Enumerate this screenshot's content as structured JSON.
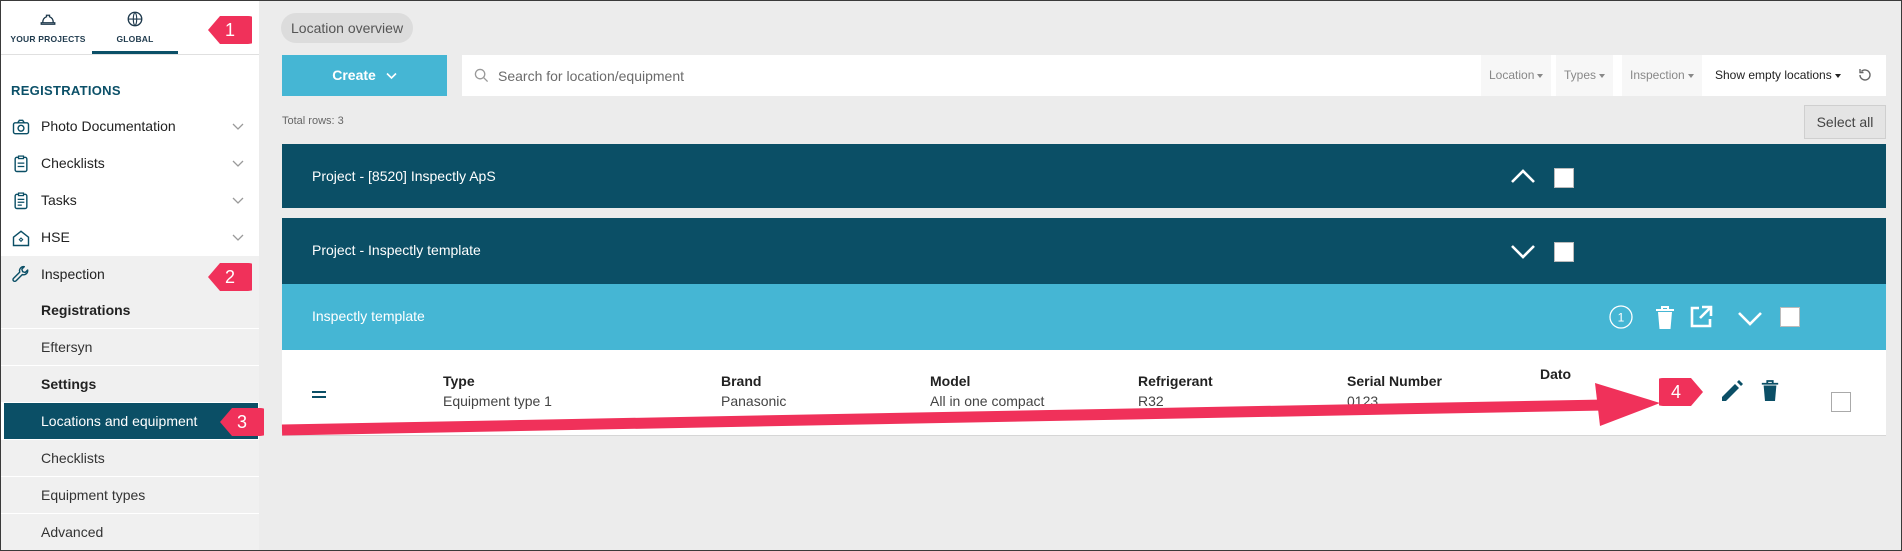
{
  "topnav": {
    "items": [
      {
        "label": "YOUR PROJECTS",
        "icon": "hard-hat-icon"
      },
      {
        "label": "GLOBAL",
        "icon": "globe-icon"
      }
    ]
  },
  "sidebar": {
    "section_title": "REGISTRATIONS",
    "items": [
      {
        "label": "Photo Documentation",
        "icon": "camera-icon"
      },
      {
        "label": "Checklists",
        "icon": "clipboard-icon"
      },
      {
        "label": "Tasks",
        "icon": "clipboard-list-icon"
      },
      {
        "label": "HSE",
        "icon": "house-icon"
      },
      {
        "label": "Inspection",
        "icon": "wrench-icon"
      }
    ],
    "inspection_subitems": [
      {
        "label": "Registrations"
      },
      {
        "label": "Eftersyn"
      },
      {
        "label": "Settings"
      },
      {
        "label": "Locations and equipment"
      },
      {
        "label": "Checklists"
      },
      {
        "label": "Equipment types"
      },
      {
        "label": "Advanced"
      }
    ]
  },
  "main": {
    "breadcrumb": "Location overview",
    "create_label": "Create",
    "search_placeholder": "Search for location/equipment",
    "filters": [
      "Location",
      "Types",
      "Inspection",
      "Show empty locations"
    ],
    "total_rows": "Total rows: 3",
    "select_all": "Select all",
    "groups": [
      {
        "title": "Project - [8520] Inspectly ApS"
      },
      {
        "title": "Project - Inspectly template"
      }
    ],
    "location": {
      "title": "Inspectly template",
      "count": "1"
    },
    "equipment_row": {
      "columns": [
        {
          "header": "Type",
          "value": "Equipment type 1"
        },
        {
          "header": "Brand",
          "value": "Panasonic"
        },
        {
          "header": "Model",
          "value": "All in one compact"
        },
        {
          "header": "Refrigerant",
          "value": "R32"
        },
        {
          "header": "Serial Number",
          "value": "0123"
        },
        {
          "header": "Dato",
          "value": ""
        }
      ]
    }
  },
  "annotations": {
    "badges": [
      "1",
      "2",
      "3",
      "4"
    ],
    "color": "#f0315a"
  },
  "colors": {
    "primary_dark": "#0b4f66",
    "primary_light": "#45b6d4",
    "annotation": "#f0315a"
  }
}
